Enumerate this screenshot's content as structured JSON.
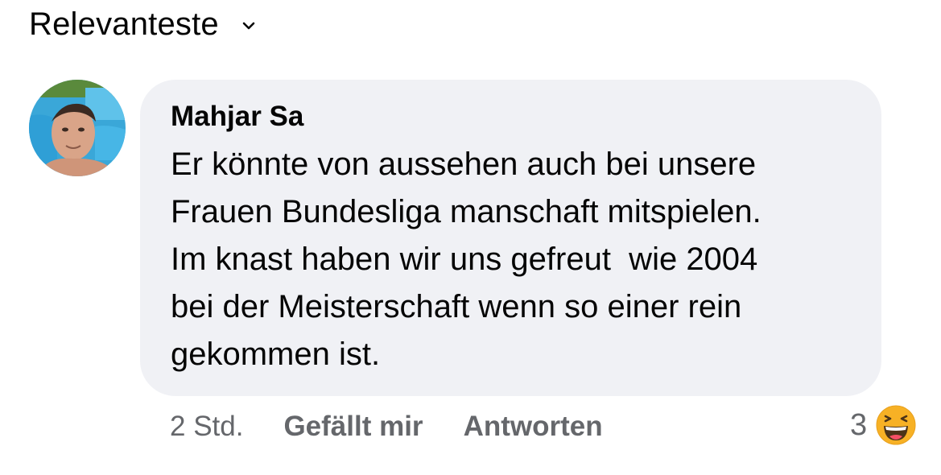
{
  "sort": {
    "label": "Relevanteste",
    "chevron_icon": "chevron-down-icon"
  },
  "comment": {
    "avatar_icon": "user-avatar",
    "author": "Mahjar Sa",
    "text_lines": [
      "Er könnte von aussehen auch bei unsere",
      "Frauen Bundesliga manschaft mitspielen.",
      "Im knast haben wir uns gefreut  wie 2004",
      "bei der Meisterschaft wenn so einer rein",
      "gekommen ist."
    ],
    "timestamp": "2 Std.",
    "like_label": "Gefällt mir",
    "reply_label": "Antworten",
    "reaction_count": "3",
    "reaction_icon": "haha-emoji-icon"
  },
  "colors": {
    "bubble_bg": "#f0f1f5",
    "text": "#050505",
    "secondary_text": "#65676b",
    "emoji_yellow": "#f7b125"
  }
}
